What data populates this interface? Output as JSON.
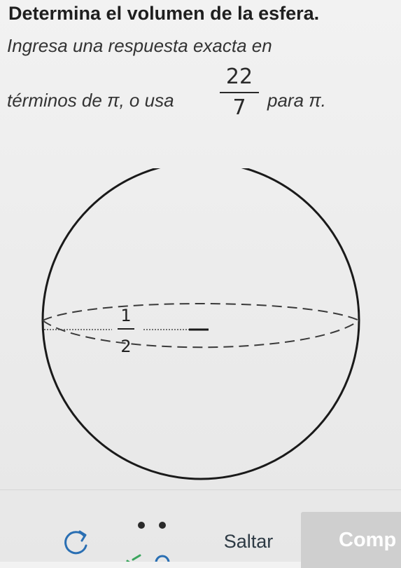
{
  "question": {
    "title": "Determina el volumen de la esfera.",
    "instruction_line1": "Ingresa una respuesta exacta en",
    "instruction_line2_before": "términos de π, o usa",
    "instruction_line2_after": "para π.",
    "pi_fraction": {
      "numerator": "22",
      "denominator": "7"
    }
  },
  "figure": {
    "radius_label": {
      "numerator": "1",
      "denominator": "2"
    }
  },
  "footer": {
    "skip_label": "Saltar",
    "check_label": "Comp",
    "refresh_icon": "refresh-icon",
    "progress_icon": "dots-progress-icon"
  },
  "colors": {
    "check_button_bg": "#cfcfcf",
    "skip_text": "#2d3a44",
    "outline": "#1a1a1a"
  }
}
